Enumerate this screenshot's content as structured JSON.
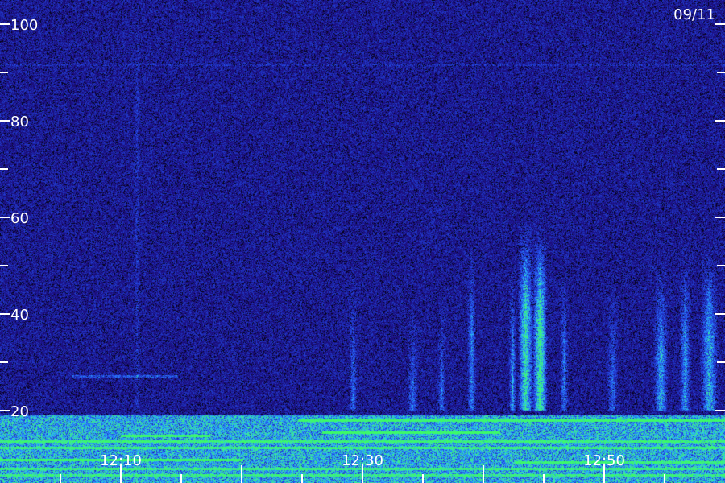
{
  "chart_data": {
    "type": "heatmap",
    "date_label": "09/11",
    "y_axis": {
      "range": [
        0,
        105
      ],
      "major_ticks": [
        20,
        40,
        60,
        80,
        100
      ],
      "minor_ticks": [
        30,
        50,
        70,
        90
      ],
      "labels": [
        "20",
        "40",
        "60",
        "80",
        "100"
      ]
    },
    "x_axis": {
      "range": [
        "12:00",
        "12:60"
      ],
      "labels": [
        "12:10",
        "12:30",
        "12:50"
      ],
      "label_minutes": [
        10,
        30,
        50
      ],
      "major_tick_minutes": [
        10,
        20,
        30,
        40,
        50
      ],
      "minor_tick_minutes": [
        5,
        15,
        25,
        35,
        45,
        55
      ]
    },
    "colors": {
      "background": "#1a0f6e",
      "low": "#0a0530",
      "mid": "#2a32c8",
      "high": "#31a8ff",
      "peak": "#3df2a0",
      "axis": "#ffffff"
    }
  }
}
